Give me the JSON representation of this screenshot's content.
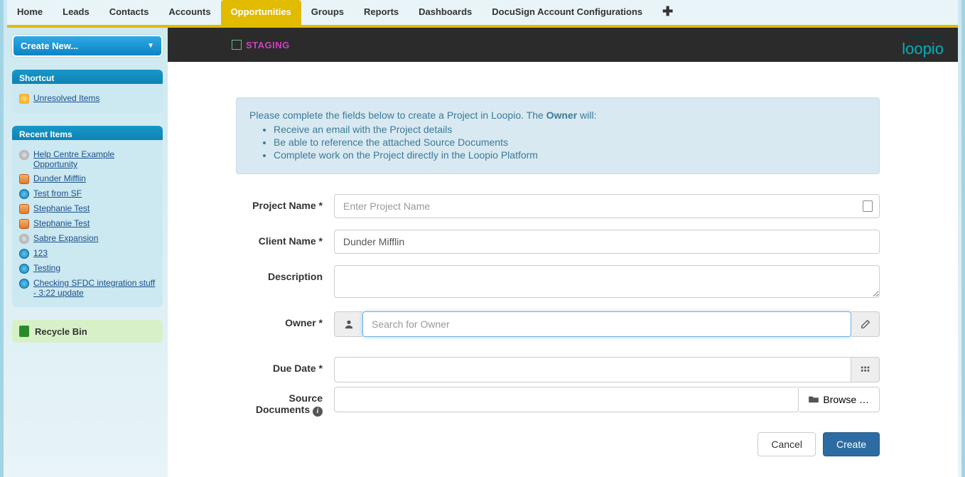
{
  "tabs": [
    "Home",
    "Leads",
    "Contacts",
    "Accounts",
    "Opportunities",
    "Groups",
    "Reports",
    "Dashboards",
    "DocuSign Account Configurations"
  ],
  "active_tab_index": 4,
  "sidebar": {
    "create_new": "Create New...",
    "shortcut_title": "Shortcut",
    "unresolved": "Unresolved Items",
    "recent_title": "Recent Items",
    "recent": [
      {
        "icon": "circle",
        "label": "Help Centre Example Opportunity"
      },
      {
        "icon": "cube",
        "label": "Dunder Mifflin"
      },
      {
        "icon": "globe",
        "label": "Test from SF"
      },
      {
        "icon": "cube",
        "label": "Stephanie Test"
      },
      {
        "icon": "cube",
        "label": "Stephanie Test"
      },
      {
        "icon": "circle",
        "label": "Sabre Expansion"
      },
      {
        "icon": "globe",
        "label": "123"
      },
      {
        "icon": "globe",
        "label": "Testing"
      },
      {
        "icon": "globe",
        "label": "Checking SFDC integration stuff - 3:22 update"
      }
    ],
    "recycle": "Recycle Bin"
  },
  "header": {
    "staging": "STAGING",
    "powered": "Powered by",
    "brand": "loopio"
  },
  "info": {
    "lead_pre": "Please complete the fields below to create a Project in Loopio. The ",
    "lead_bold": "Owner",
    "lead_post": " will:",
    "bullets": [
      "Receive an email with the Project details",
      "Be able to reference the attached Source Documents",
      "Complete work on the Project directly in the Loopio Platform"
    ]
  },
  "form": {
    "project_name_label": "Project Name *",
    "project_name_placeholder": "Enter Project Name",
    "client_name_label": "Client Name *",
    "client_name_value": "Dunder Mifflin",
    "description_label": "Description",
    "owner_label": "Owner *",
    "owner_placeholder": "Search for Owner",
    "due_date_label": "Due Date *",
    "source_docs_label_1": "Source",
    "source_docs_label_2": "Documents ",
    "browse": "Browse …"
  },
  "actions": {
    "cancel": "Cancel",
    "create": "Create"
  }
}
